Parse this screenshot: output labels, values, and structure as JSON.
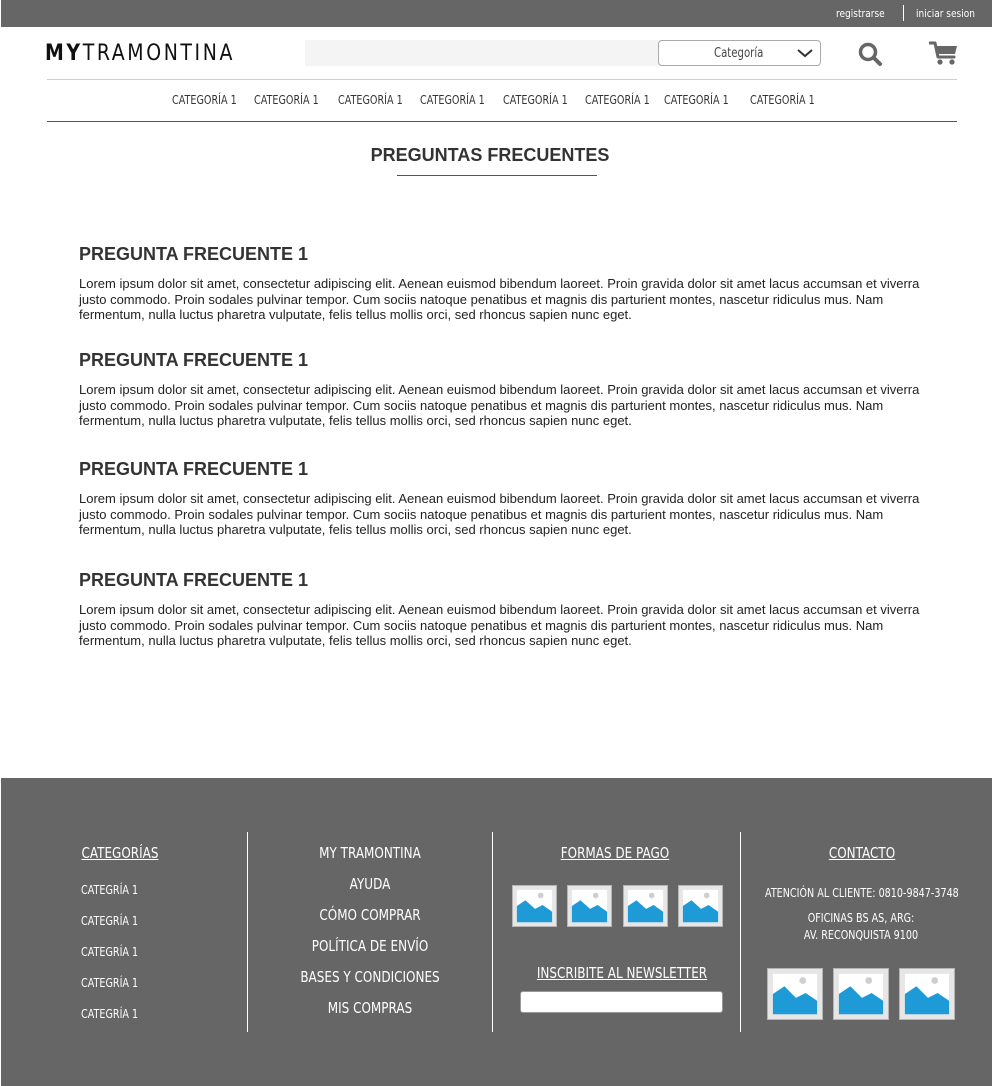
{
  "topbar": {
    "register_label": "registrarse",
    "login_label": "iniciar sesion"
  },
  "header": {
    "logo_my": "MY",
    "logo_rest": "TRAMONTINA",
    "search_placeholder": "",
    "category_select_value": "Categoría"
  },
  "nav": {
    "items": [
      "CATEGORÍA 1",
      "CATEGORÍA 1",
      "CATEGORÍA 1",
      "CATEGORÍA 1",
      "CATEGORÍA 1",
      "CATEGORÍA 1",
      "CATEGORÍA 1",
      "CATEGORÍA 1"
    ]
  },
  "main": {
    "title": "PREGUNTAS FRECUENTES",
    "faqs": [
      {
        "question": "PREGUNTA FRECUENTE 1",
        "answer": "Lorem ipsum dolor sit amet, consectetur adipiscing elit. Aenean euismod bibendum laoreet. Proin gravida dolor sit amet lacus accumsan et viverra justo commodo. Proin sodales pulvinar tempor. Cum sociis natoque penatibus et magnis dis parturient montes, nascetur ridiculus mus. Nam fermentum, nulla luctus pharetra vulputate, felis tellus mollis orci, sed rhoncus sapien nunc eget."
      },
      {
        "question": "PREGUNTA FRECUENTE 1",
        "answer": "Lorem ipsum dolor sit amet, consectetur adipiscing elit. Aenean euismod bibendum laoreet. Proin gravida dolor sit amet lacus accumsan et viverra justo commodo. Proin sodales pulvinar tempor. Cum sociis natoque penatibus et magnis dis parturient montes, nascetur ridiculus mus. Nam fermentum, nulla luctus pharetra vulputate, felis tellus mollis orci, sed rhoncus sapien nunc eget."
      },
      {
        "question": "PREGUNTA FRECUENTE 1",
        "answer": "Lorem ipsum dolor sit amet, consectetur adipiscing elit. Aenean euismod bibendum laoreet. Proin gravida dolor sit amet lacus accumsan et viverra justo commodo. Proin sodales pulvinar tempor. Cum sociis natoque penatibus et magnis dis parturient montes, nascetur ridiculus mus. Nam fermentum, nulla luctus pharetra vulputate, felis tellus mollis orci, sed rhoncus sapien nunc eget."
      },
      {
        "question": "PREGUNTA FRECUENTE 1",
        "answer": "Lorem ipsum dolor sit amet, consectetur adipiscing elit. Aenean euismod bibendum laoreet. Proin gravida dolor sit amet lacus accumsan et viverra justo commodo. Proin sodales pulvinar tempor. Cum sociis natoque penatibus et magnis dis parturient montes, nascetur ridiculus mus. Nam fermentum, nulla luctus pharetra vulputate, felis tellus mollis orci, sed rhoncus sapien nunc eget."
      }
    ]
  },
  "footer": {
    "categories_heading": "CATEGORÍAS",
    "categories": [
      "CATEGRÍA 1",
      "CATEGRÍA 1",
      "CATEGRÍA 1",
      "CATEGRÍA 1",
      "CATEGRÍA 1"
    ],
    "links": [
      "MY TRAMONTINA",
      "AYUDA",
      "CÓMO COMPRAR",
      "POLÍTICA DE ENVÍO",
      "BASES Y CONDICIONES",
      "MIS COMPRAS"
    ],
    "payment_heading": "FORMAS DE PAGO",
    "newsletter_heading": "INSCRIBITE AL NEWSLETTER",
    "newsletter_placeholder": "",
    "contact_heading": "CONTACTO",
    "customer_service": "ATENCIÓN AL CLIENTE: 0810-9847-3748",
    "office_line1": "OFICINAS BS AS, ARG:",
    "office_line2": "AV. RECONQUISTA 9100"
  },
  "colors": {
    "bar_gray": "#666666",
    "placeholder_blue": "#1e9ad6",
    "placeholder_bg": "#e6e6e6"
  },
  "icons": {
    "search": "search-icon",
    "cart": "cart-icon",
    "dropdown": "chevron-down-icon",
    "image": "image-placeholder-icon"
  }
}
